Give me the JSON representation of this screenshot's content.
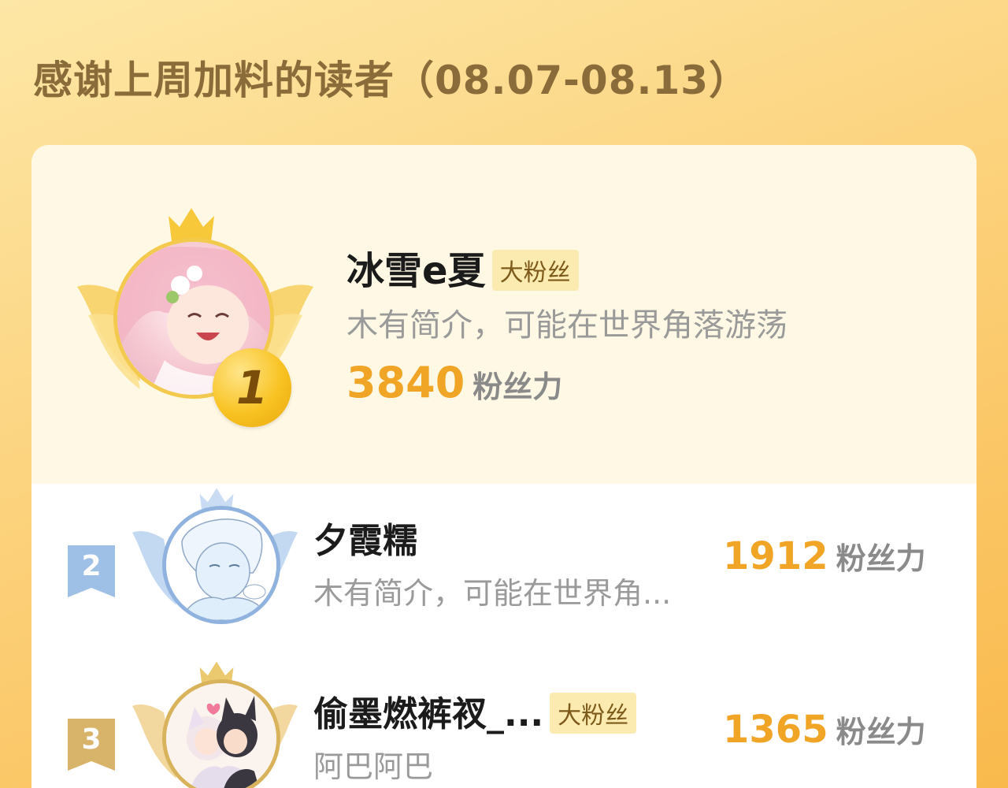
{
  "header": {
    "title": "感谢上周加料的读者（08.07-08.13）"
  },
  "colors": {
    "accent_gold": "#f0a526",
    "badge_bg": "#fbebb1",
    "silver": "#9fc0e6",
    "bronze": "#d8b46a"
  },
  "readers": [
    {
      "rank": "1",
      "name": "冰雪e夏",
      "badge": "大粉丝",
      "bio": "木有简介，可能在世界角落游荡",
      "score": "3840",
      "score_unit": "粉丝力"
    },
    {
      "rank": "2",
      "name": "夕霞糯",
      "badge": "",
      "bio": "木有简介，可能在世界角...",
      "score": "1912",
      "score_unit": "粉丝力"
    },
    {
      "rank": "3",
      "name": "偷墨燃裤衩_...",
      "badge": "大粉丝",
      "bio": "阿巴阿巴",
      "score": "1365",
      "score_unit": "粉丝力"
    }
  ],
  "icons": [
    "crown-icon",
    "wings-icon",
    "rank-medal-icon",
    "rank-ribbon-icon"
  ]
}
